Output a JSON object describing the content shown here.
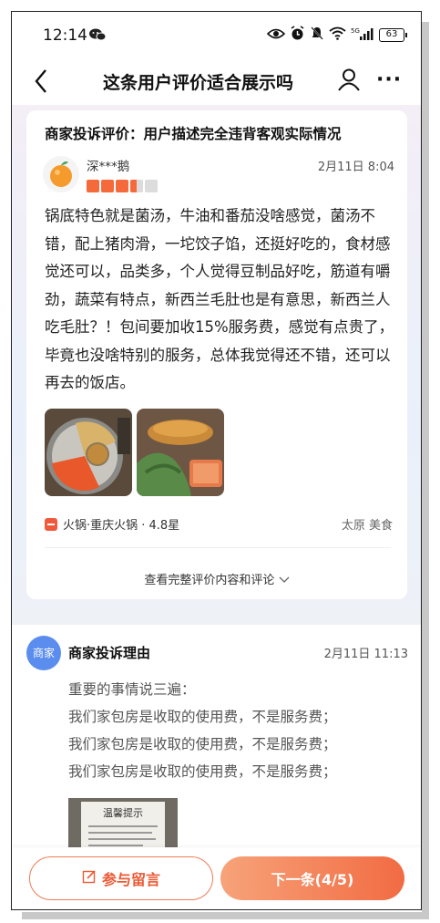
{
  "status_bar": {
    "time": "12:14",
    "battery": "63",
    "network": "5G",
    "icons": [
      "wechat-icon",
      "eye-icon",
      "alarm-icon",
      "mute-icon",
      "wifi-icon",
      "signal-icon",
      "battery-icon"
    ]
  },
  "header": {
    "title": "这条用户评价适合展示吗",
    "icons": [
      "back-icon",
      "user-icon",
      "more-icon"
    ]
  },
  "review": {
    "complaint_title": "商家投诉评价：用户描述完全违背客观实际情况",
    "reviewer": "深***鹅",
    "date": "2月11日  8:04",
    "rating": 3.5,
    "text": "锅底特色就是菌汤，牛油和番茄没啥感觉，菌汤不错，配上猪肉滑，一坨饺子馅，还挺好吃的，食材感觉还可以，品类多，个人觉得豆制品好吃，筋道有嚼劲，蔬菜有特点，新西兰毛肚也是有意思，新西兰人吃毛肚？！包间要加收15%服务费，感觉有点贵了，毕竟也没啥特别的服务，总体我觉得还不错，还可以再去的饭店。",
    "tag": "火锅·重庆火锅 · 4.8星",
    "city": "太原 美食",
    "view_full": "查看完整评价内容和评论"
  },
  "merchant": {
    "badge": "商家",
    "title": "商家投诉理由",
    "date": "2月11日  11:13",
    "lines": [
      "重要的事情说三遍：",
      "我们家包房是收取的使用费，不是服务费；",
      "我们家包房是收取的使用费，不是服务费；",
      "我们家包房是收取的使用费，不是服务费；"
    ],
    "photo_text": "温馨提示"
  },
  "footer": {
    "comment_label": "参与留言",
    "next_label": "下一条(4/5)"
  },
  "colors": {
    "accent": "#f26b42",
    "star": "#f56a3b",
    "merchant_badge": "#5b8dee"
  }
}
